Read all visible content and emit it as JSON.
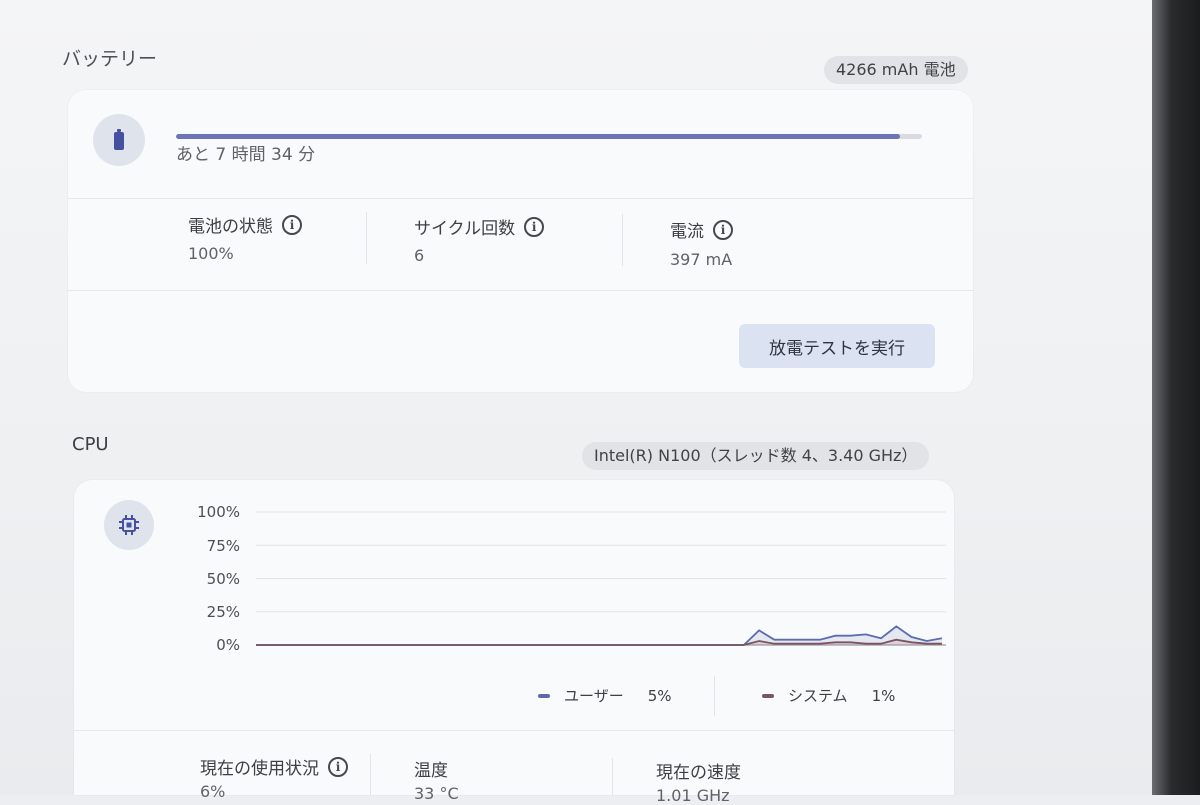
{
  "battery": {
    "title": "バッテリー",
    "capacity_chip": "4266 mAh 電池",
    "time_remaining": "あと 7 時間 34 分",
    "charge_fraction": 0.97,
    "stats": [
      {
        "label": "電池の状態",
        "value": "100%"
      },
      {
        "label": "サイクル回数",
        "value": "6"
      },
      {
        "label": "電流",
        "value": "397 mA"
      }
    ],
    "discharge_button": "放電テストを実行"
  },
  "cpu": {
    "title": "CPU",
    "model_chip": "Intel(R) N100（スレッド数 4、3.40 GHz）",
    "legend": [
      {
        "label": "ユーザー",
        "value": "5%",
        "color": "#5c6bb0"
      },
      {
        "label": "システム",
        "value": "1%",
        "color": "#7a5560"
      }
    ],
    "stats": [
      {
        "label": "現在の使用状況",
        "value": "6%"
      },
      {
        "label": "温度",
        "value": "33 °C"
      },
      {
        "label": "現在の速度",
        "value": "1.01 GHz"
      }
    ]
  },
  "chart_data": {
    "type": "area",
    "y_ticks": [
      "100%",
      "75%",
      "50%",
      "25%",
      "0%"
    ],
    "ylim": [
      0,
      100
    ],
    "x": [
      0,
      1,
      2,
      3,
      4,
      5,
      6,
      7,
      8,
      9,
      10,
      11,
      12,
      13,
      14,
      15,
      16,
      17,
      18,
      19,
      20,
      21,
      22,
      23,
      24,
      25,
      26,
      27,
      28,
      29,
      30,
      31,
      32,
      33,
      34,
      35,
      36,
      37,
      38,
      39,
      40,
      41,
      42,
      43,
      44,
      45
    ],
    "series": [
      {
        "name": "ユーザー",
        "color": "#5c6bb0",
        "values": [
          0,
          0,
          0,
          0,
          0,
          0,
          0,
          0,
          0,
          0,
          0,
          0,
          0,
          0,
          0,
          0,
          0,
          0,
          0,
          0,
          0,
          0,
          0,
          0,
          0,
          0,
          0,
          0,
          0,
          0,
          0,
          0,
          0,
          11,
          4,
          4,
          4,
          4,
          7,
          7,
          8,
          5,
          14,
          6,
          3,
          5
        ]
      },
      {
        "name": "システム",
        "color": "#7a5560",
        "values": [
          0,
          0,
          0,
          0,
          0,
          0,
          0,
          0,
          0,
          0,
          0,
          0,
          0,
          0,
          0,
          0,
          0,
          0,
          0,
          0,
          0,
          0,
          0,
          0,
          0,
          0,
          0,
          0,
          0,
          0,
          0,
          0,
          0,
          3,
          1,
          1,
          1,
          1,
          2,
          2,
          1,
          1,
          4,
          2,
          1,
          1
        ]
      }
    ],
    "grid": true
  }
}
